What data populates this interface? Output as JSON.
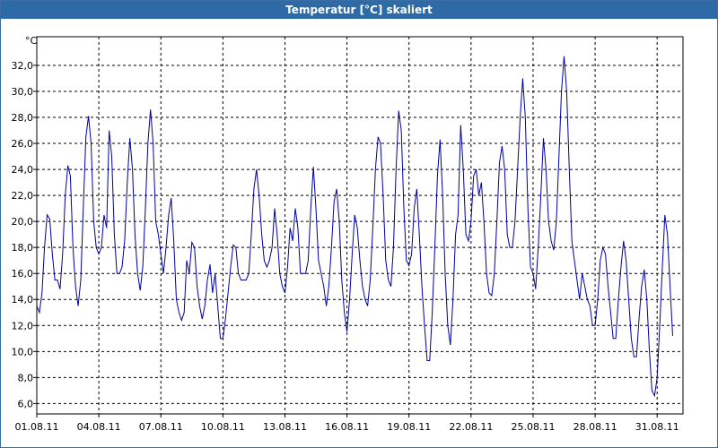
{
  "window": {
    "title": "Temperatur [°C] skaliert"
  },
  "chart_data": {
    "type": "line",
    "title": "Temperatur [°C] skaliert",
    "ylabel": "°C",
    "xlabel": "",
    "x_tick_labels": [
      "01.08.11",
      "04.08.11",
      "07.08.11",
      "10.08.11",
      "13.08.11",
      "16.08.11",
      "19.08.11",
      "22.08.11",
      "25.08.11",
      "28.08.11",
      "31.08.11"
    ],
    "y_tick_labels": [
      "6,0",
      "8,0",
      "10,0",
      "12,0",
      "14,0",
      "16,0",
      "18,0",
      "20,0",
      "22,0",
      "24,0",
      "26,0",
      "28,0",
      "30,0",
      "32,0"
    ],
    "ylim": [
      5.2,
      34.2
    ],
    "xlim": [
      "2011-08-01T00:00",
      "2011-09-01T06:00"
    ],
    "grid": true,
    "line_color": "#0000a0",
    "series": [
      {
        "points": [
          [
            "2011-08-01T00:00",
            13.5
          ],
          [
            "2011-08-01T03:00",
            13.0
          ],
          [
            "2011-08-01T06:00",
            14.5
          ],
          [
            "2011-08-01T09:00",
            18.0
          ],
          [
            "2011-08-01T12:00",
            20.5
          ],
          [
            "2011-08-01T15:00",
            20.2
          ],
          [
            "2011-08-01T18:00",
            17.5
          ],
          [
            "2011-08-01T21:00",
            15.5
          ],
          [
            "2011-08-02T00:00",
            15.5
          ],
          [
            "2011-08-02T03:00",
            14.8
          ],
          [
            "2011-08-02T06:00",
            17.5
          ],
          [
            "2011-08-02T09:00",
            22.0
          ],
          [
            "2011-08-02T12:00",
            24.3
          ],
          [
            "2011-08-02T15:00",
            23.5
          ],
          [
            "2011-08-02T18:00",
            18.0
          ],
          [
            "2011-08-02T21:00",
            15.0
          ],
          [
            "2011-08-03T00:00",
            13.5
          ],
          [
            "2011-08-03T03:00",
            15.5
          ],
          [
            "2011-08-03T06:00",
            21.0
          ],
          [
            "2011-08-03T09:00",
            26.5
          ],
          [
            "2011-08-03T12:00",
            28.1
          ],
          [
            "2011-08-03T15:00",
            26.0
          ],
          [
            "2011-08-03T18:00",
            20.0
          ],
          [
            "2011-08-03T21:00",
            18.0
          ],
          [
            "2011-08-04T00:00",
            17.5
          ],
          [
            "2011-08-04T03:00",
            18.0
          ],
          [
            "2011-08-04T06:00",
            20.5
          ],
          [
            "2011-08-04T09:00",
            19.5
          ],
          [
            "2011-08-04T12:00",
            27.0
          ],
          [
            "2011-08-04T15:00",
            25.0
          ],
          [
            "2011-08-04T18:00",
            19.0
          ],
          [
            "2011-08-04T21:00",
            16.0
          ],
          [
            "2011-08-05T00:00",
            16.0
          ],
          [
            "2011-08-05T03:00",
            16.5
          ],
          [
            "2011-08-05T06:00",
            18.5
          ],
          [
            "2011-08-05T09:00",
            23.0
          ],
          [
            "2011-08-05T12:00",
            26.4
          ],
          [
            "2011-08-05T15:00",
            24.0
          ],
          [
            "2011-08-05T18:00",
            19.0
          ],
          [
            "2011-08-05T21:00",
            16.0
          ],
          [
            "2011-08-06T00:00",
            14.7
          ],
          [
            "2011-08-06T03:00",
            16.5
          ],
          [
            "2011-08-06T06:00",
            21.0
          ],
          [
            "2011-08-06T09:00",
            26.0
          ],
          [
            "2011-08-06T12:00",
            28.6
          ],
          [
            "2011-08-06T15:00",
            26.0
          ],
          [
            "2011-08-06T18:00",
            20.0
          ],
          [
            "2011-08-06T21:00",
            19.0
          ],
          [
            "2011-08-07T00:00",
            17.5
          ],
          [
            "2011-08-07T03:00",
            16.0
          ],
          [
            "2011-08-07T06:00",
            18.0
          ],
          [
            "2011-08-07T09:00",
            20.5
          ],
          [
            "2011-08-07T12:00",
            21.8
          ],
          [
            "2011-08-07T15:00",
            18.5
          ],
          [
            "2011-08-07T18:00",
            14.0
          ],
          [
            "2011-08-07T21:00",
            13.0
          ],
          [
            "2011-08-08T00:00",
            12.4
          ],
          [
            "2011-08-08T03:00",
            13.0
          ],
          [
            "2011-08-08T06:00",
            17.0
          ],
          [
            "2011-08-08T09:00",
            16.0
          ],
          [
            "2011-08-08T12:00",
            18.4
          ],
          [
            "2011-08-08T15:00",
            18.0
          ],
          [
            "2011-08-08T18:00",
            15.0
          ],
          [
            "2011-08-08T21:00",
            13.5
          ],
          [
            "2011-08-09T00:00",
            12.5
          ],
          [
            "2011-08-09T03:00",
            13.5
          ],
          [
            "2011-08-09T06:00",
            15.5
          ],
          [
            "2011-08-09T09:00",
            16.7
          ],
          [
            "2011-08-09T12:00",
            14.5
          ],
          [
            "2011-08-09T15:00",
            16.0
          ],
          [
            "2011-08-09T18:00",
            13.5
          ],
          [
            "2011-08-09T21:00",
            11.0
          ],
          [
            "2011-08-10T00:00",
            11.0
          ],
          [
            "2011-08-10T03:00",
            12.5
          ],
          [
            "2011-08-10T06:00",
            14.5
          ],
          [
            "2011-08-10T09:00",
            16.5
          ],
          [
            "2011-08-10T12:00",
            18.2
          ],
          [
            "2011-08-10T15:00",
            18.0
          ],
          [
            "2011-08-10T18:00",
            16.0
          ],
          [
            "2011-08-10T21:00",
            15.5
          ],
          [
            "2011-08-11T00:00",
            15.5
          ],
          [
            "2011-08-11T03:00",
            15.5
          ],
          [
            "2011-08-11T06:00",
            16.0
          ],
          [
            "2011-08-11T09:00",
            19.0
          ],
          [
            "2011-08-11T12:00",
            22.5
          ],
          [
            "2011-08-11T15:00",
            24.0
          ],
          [
            "2011-08-11T18:00",
            22.0
          ],
          [
            "2011-08-11T21:00",
            19.0
          ],
          [
            "2011-08-12T00:00",
            17.0
          ],
          [
            "2011-08-12T03:00",
            16.5
          ],
          [
            "2011-08-12T06:00",
            17.0
          ],
          [
            "2011-08-12T09:00",
            18.0
          ],
          [
            "2011-08-12T12:00",
            21.0
          ],
          [
            "2011-08-12T15:00",
            19.0
          ],
          [
            "2011-08-12T18:00",
            16.0
          ],
          [
            "2011-08-12T21:00",
            15.0
          ],
          [
            "2011-08-13T00:00",
            14.5
          ],
          [
            "2011-08-13T03:00",
            16.5
          ],
          [
            "2011-08-13T06:00",
            19.5
          ],
          [
            "2011-08-13T09:00",
            18.5
          ],
          [
            "2011-08-13T12:00",
            21.0
          ],
          [
            "2011-08-13T15:00",
            19.5
          ],
          [
            "2011-08-13T18:00",
            16.0
          ],
          [
            "2011-08-13T21:00",
            16.0
          ],
          [
            "2011-08-14T00:00",
            16.0
          ],
          [
            "2011-08-14T03:00",
            17.0
          ],
          [
            "2011-08-14T06:00",
            21.0
          ],
          [
            "2011-08-14T09:00",
            24.2
          ],
          [
            "2011-08-14T12:00",
            21.0
          ],
          [
            "2011-08-14T15:00",
            17.0
          ],
          [
            "2011-08-14T18:00",
            16.0
          ],
          [
            "2011-08-14T21:00",
            15.0
          ],
          [
            "2011-08-15T00:00",
            13.5
          ],
          [
            "2011-08-15T03:00",
            15.0
          ],
          [
            "2011-08-15T06:00",
            18.0
          ],
          [
            "2011-08-15T09:00",
            21.5
          ],
          [
            "2011-08-15T12:00",
            22.5
          ],
          [
            "2011-08-15T15:00",
            20.0
          ],
          [
            "2011-08-15T18:00",
            15.5
          ],
          [
            "2011-08-15T21:00",
            13.0
          ],
          [
            "2011-08-16T00:00",
            11.5
          ],
          [
            "2011-08-16T03:00",
            14.0
          ],
          [
            "2011-08-16T06:00",
            17.5
          ],
          [
            "2011-08-16T09:00",
            20.5
          ],
          [
            "2011-08-16T12:00",
            19.5
          ],
          [
            "2011-08-16T15:00",
            17.0
          ],
          [
            "2011-08-16T18:00",
            15.0
          ],
          [
            "2011-08-16T21:00",
            14.0
          ],
          [
            "2011-08-17T00:00",
            13.5
          ],
          [
            "2011-08-17T03:00",
            15.5
          ],
          [
            "2011-08-17T06:00",
            19.5
          ],
          [
            "2011-08-17T09:00",
            24.0
          ],
          [
            "2011-08-17T12:00",
            26.5
          ],
          [
            "2011-08-17T15:00",
            26.0
          ],
          [
            "2011-08-17T18:00",
            22.0
          ],
          [
            "2011-08-17T21:00",
            17.0
          ],
          [
            "2011-08-18T00:00",
            15.5
          ],
          [
            "2011-08-18T03:00",
            15.0
          ],
          [
            "2011-08-18T06:00",
            18.0
          ],
          [
            "2011-08-18T09:00",
            24.0
          ],
          [
            "2011-08-18T12:00",
            28.5
          ],
          [
            "2011-08-18T15:00",
            27.0
          ],
          [
            "2011-08-18T18:00",
            21.0
          ],
          [
            "2011-08-18T21:00",
            17.0
          ],
          [
            "2011-08-19T00:00",
            16.6
          ],
          [
            "2011-08-19T03:00",
            17.5
          ],
          [
            "2011-08-19T06:00",
            21.0
          ],
          [
            "2011-08-19T09:00",
            22.5
          ],
          [
            "2011-08-19T12:00",
            19.0
          ],
          [
            "2011-08-19T15:00",
            15.0
          ],
          [
            "2011-08-19T18:00",
            12.0
          ],
          [
            "2011-08-19T21:00",
            9.3
          ],
          [
            "2011-08-20T00:00",
            9.3
          ],
          [
            "2011-08-20T03:00",
            13.0
          ],
          [
            "2011-08-20T06:00",
            18.0
          ],
          [
            "2011-08-20T09:00",
            23.5
          ],
          [
            "2011-08-20T12:00",
            26.3
          ],
          [
            "2011-08-20T15:00",
            22.0
          ],
          [
            "2011-08-20T18:00",
            16.0
          ],
          [
            "2011-08-20T21:00",
            12.0
          ],
          [
            "2011-08-21T00:00",
            10.5
          ],
          [
            "2011-08-21T03:00",
            14.0
          ],
          [
            "2011-08-21T06:00",
            19.0
          ],
          [
            "2011-08-21T09:00",
            20.5
          ],
          [
            "2011-08-21T12:00",
            27.4
          ],
          [
            "2011-08-21T15:00",
            24.0
          ],
          [
            "2011-08-21T18:00",
            19.0
          ],
          [
            "2011-08-21T21:00",
            18.5
          ],
          [
            "2011-08-22T00:00",
            20.0
          ],
          [
            "2011-08-22T03:00",
            23.5
          ],
          [
            "2011-08-22T06:00",
            24.0
          ],
          [
            "2011-08-22T09:00",
            22.0
          ],
          [
            "2011-08-22T12:00",
            23.0
          ],
          [
            "2011-08-22T15:00",
            20.0
          ],
          [
            "2011-08-22T18:00",
            16.0
          ],
          [
            "2011-08-22T21:00",
            14.5
          ],
          [
            "2011-08-23T00:00",
            14.3
          ],
          [
            "2011-08-23T03:00",
            16.0
          ],
          [
            "2011-08-23T06:00",
            20.0
          ],
          [
            "2011-08-23T09:00",
            24.5
          ],
          [
            "2011-08-23T12:00",
            25.8
          ],
          [
            "2011-08-23T15:00",
            24.0
          ],
          [
            "2011-08-23T18:00",
            19.0
          ],
          [
            "2011-08-23T21:00",
            18.0
          ],
          [
            "2011-08-24T00:00",
            18.0
          ],
          [
            "2011-08-24T03:00",
            20.0
          ],
          [
            "2011-08-24T06:00",
            24.0
          ],
          [
            "2011-08-24T09:00",
            28.0
          ],
          [
            "2011-08-24T12:00",
            31.0
          ],
          [
            "2011-08-24T15:00",
            28.0
          ],
          [
            "2011-08-24T18:00",
            21.0
          ],
          [
            "2011-08-24T21:00",
            16.5
          ],
          [
            "2011-08-25T00:00",
            16.0
          ],
          [
            "2011-08-25T03:00",
            14.8
          ],
          [
            "2011-08-25T06:00",
            18.0
          ],
          [
            "2011-08-25T09:00",
            22.0
          ],
          [
            "2011-08-25T12:00",
            26.4
          ],
          [
            "2011-08-25T15:00",
            24.0
          ],
          [
            "2011-08-25T18:00",
            20.0
          ],
          [
            "2011-08-25T21:00",
            18.5
          ],
          [
            "2011-08-26T00:00",
            17.8
          ],
          [
            "2011-08-26T03:00",
            20.0
          ],
          [
            "2011-08-26T06:00",
            25.0
          ],
          [
            "2011-08-26T09:00",
            30.0
          ],
          [
            "2011-08-26T12:00",
            32.7
          ],
          [
            "2011-08-26T15:00",
            30.0
          ],
          [
            "2011-08-26T18:00",
            24.0
          ],
          [
            "2011-08-26T21:00",
            18.5
          ],
          [
            "2011-08-27T00:00",
            17.0
          ],
          [
            "2011-08-27T03:00",
            15.5
          ],
          [
            "2011-08-27T06:00",
            14.0
          ],
          [
            "2011-08-27T09:00",
            16.0
          ],
          [
            "2011-08-27T12:00",
            15.0
          ],
          [
            "2011-08-27T15:00",
            14.0
          ],
          [
            "2011-08-27T18:00",
            13.5
          ],
          [
            "2011-08-27T21:00",
            12.0
          ],
          [
            "2011-08-28T00:00",
            12.0
          ],
          [
            "2011-08-28T03:00",
            14.0
          ],
          [
            "2011-08-28T06:00",
            17.0
          ],
          [
            "2011-08-28T09:00",
            18.0
          ],
          [
            "2011-08-28T12:00",
            17.5
          ],
          [
            "2011-08-28T15:00",
            15.0
          ],
          [
            "2011-08-28T18:00",
            13.0
          ],
          [
            "2011-08-28T21:00",
            11.0
          ],
          [
            "2011-08-29T00:00",
            11.0
          ],
          [
            "2011-08-29T03:00",
            14.0
          ],
          [
            "2011-08-29T06:00",
            16.5
          ],
          [
            "2011-08-29T09:00",
            18.5
          ],
          [
            "2011-08-29T12:00",
            17.0
          ],
          [
            "2011-08-29T15:00",
            14.0
          ],
          [
            "2011-08-29T18:00",
            11.0
          ],
          [
            "2011-08-29T21:00",
            9.6
          ],
          [
            "2011-08-30T00:00",
            9.6
          ],
          [
            "2011-08-30T03:00",
            12.5
          ],
          [
            "2011-08-30T06:00",
            15.0
          ],
          [
            "2011-08-30T09:00",
            16.3
          ],
          [
            "2011-08-30T12:00",
            14.0
          ],
          [
            "2011-08-30T15:00",
            10.0
          ],
          [
            "2011-08-30T18:00",
            7.0
          ],
          [
            "2011-08-30T21:00",
            6.6
          ],
          [
            "2011-08-31T00:00",
            8.0
          ],
          [
            "2011-08-31T03:00",
            12.0
          ],
          [
            "2011-08-31T06:00",
            16.5
          ],
          [
            "2011-08-31T09:00",
            20.5
          ],
          [
            "2011-08-31T12:00",
            19.0
          ],
          [
            "2011-08-31T15:00",
            15.0
          ],
          [
            "2011-08-31T18:00",
            11.2
          ]
        ]
      }
    ]
  }
}
